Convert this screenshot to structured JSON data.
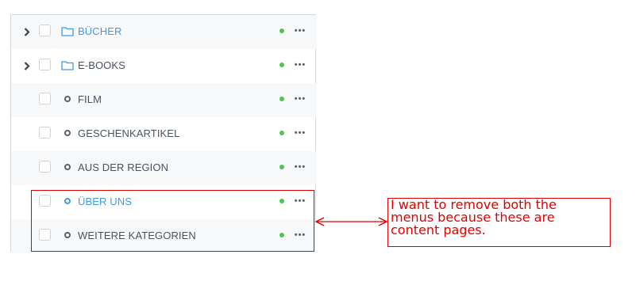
{
  "tree": {
    "rows": [
      {
        "label": "BÜCHER",
        "expandable": true,
        "icon": "folder-icon",
        "highlight": true
      },
      {
        "label": "E-BOOKS",
        "expandable": true,
        "icon": "folder-icon",
        "highlight": false
      },
      {
        "label": "FILM",
        "expandable": false,
        "icon": "circle-icon",
        "highlight": false
      },
      {
        "label": "GESCHENKARTIKEL",
        "expandable": false,
        "icon": "circle-icon",
        "highlight": false
      },
      {
        "label": "AUS DER REGION",
        "expandable": false,
        "icon": "circle-icon",
        "highlight": false
      },
      {
        "label": "ÜBER UNS",
        "expandable": false,
        "icon": "circle-icon",
        "highlight": true
      },
      {
        "label": "WEITERE KATEGORIEN",
        "expandable": false,
        "icon": "circle-icon",
        "highlight": false
      }
    ],
    "more_label": "•••"
  },
  "annotation": {
    "note": "I want to remove both the menus because these are content pages.",
    "note_lines": [
      "I want to remove both the",
      "menus because these are",
      "content pages."
    ]
  },
  "colors": {
    "accent": "#3d9be9",
    "status_green": "#4cc74c",
    "annotation_red": "#e00000",
    "text": "#4a5260"
  }
}
